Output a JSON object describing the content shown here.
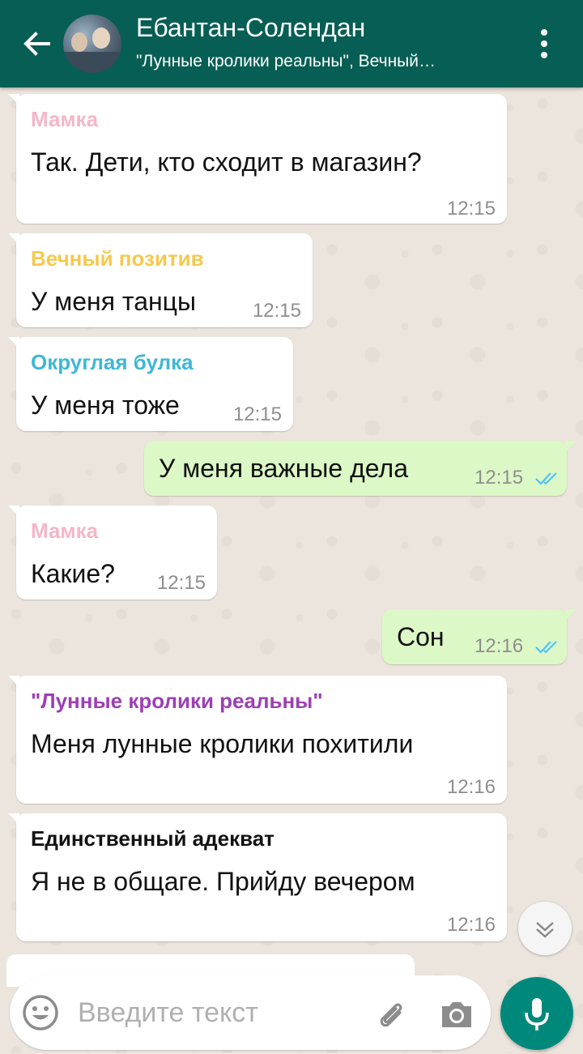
{
  "header": {
    "title": "Ебантан-Солендан",
    "subtitle": "\"Лунные кролики реальны\", Вечный…",
    "back_icon": "arrow-left-icon",
    "menu_icon": "more-vert-icon",
    "color": "#075e54"
  },
  "messages": [
    {
      "sender": "Мамка",
      "sender_color": "#f4b6c8",
      "text": "Так. Дети, кто сходит в магазин?",
      "time": "12:15",
      "direction": "in"
    },
    {
      "sender": "Вечный позитив",
      "sender_color": "#f5c94e",
      "text": "У меня танцы",
      "time": "12:15",
      "direction": "in"
    },
    {
      "sender": "Округлая булка",
      "sender_color": "#3fb7d6",
      "text": "У меня тоже",
      "time": "12:15",
      "direction": "in"
    },
    {
      "sender": "",
      "text": "У меня важные дела",
      "time": "12:15",
      "direction": "out",
      "status": "read"
    },
    {
      "sender": "Мамка",
      "sender_color": "#f4b6c8",
      "text": "Какие?",
      "time": "12:15",
      "direction": "in"
    },
    {
      "sender": "",
      "text": "Сон",
      "time": "12:16",
      "direction": "out",
      "status": "read"
    },
    {
      "sender": "\"Лунные кролики реальны\"",
      "sender_color": "#9c3fb5",
      "text": "Меня лунные кролики похитили",
      "time": "12:16",
      "direction": "in"
    },
    {
      "sender": "Единственный адекват",
      "sender_color": "#111111",
      "text": "Я не в общаге. Прийду вечером",
      "time": "12:16",
      "direction": "in"
    }
  ],
  "composer": {
    "placeholder": "Введите текст",
    "value": "",
    "emoji_icon": "emoji-icon",
    "attach_icon": "paperclip-icon",
    "camera_icon": "camera-icon",
    "mic_icon": "microphone-icon"
  },
  "colors": {
    "incoming_bubble": "#ffffff",
    "outgoing_bubble": "#dcf8c6",
    "read_ticks": "#4fc3f7",
    "accent": "#00897b",
    "chat_background": "#ece5dd"
  }
}
